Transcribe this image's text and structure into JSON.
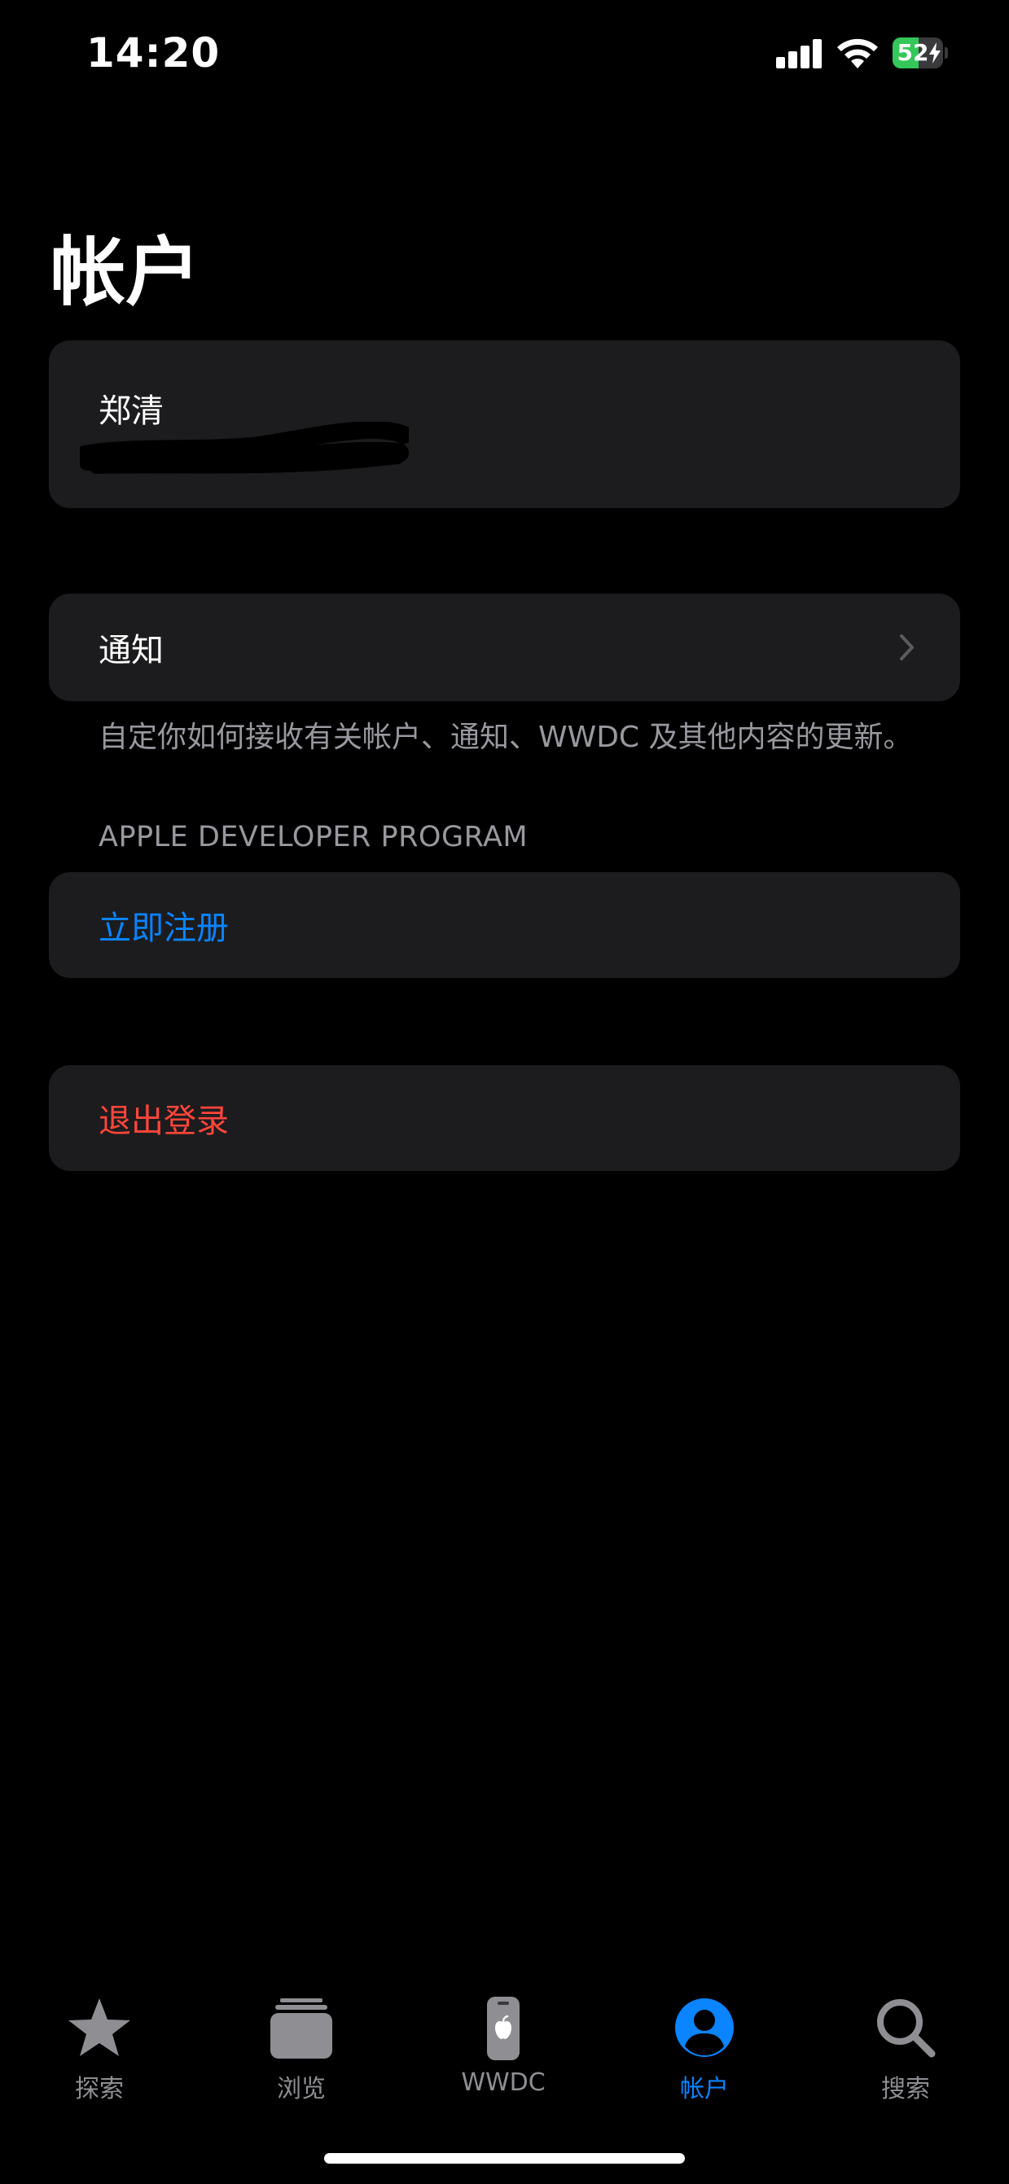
{
  "status_bar": {
    "time": "14:20",
    "battery_level": "52",
    "battery_fraction": 0.52,
    "charging": true,
    "icons": [
      "cellular-signal-icon",
      "wifi-icon",
      "battery-charging-icon"
    ]
  },
  "page": {
    "title": "帐户"
  },
  "profile": {
    "name": "郑清"
  },
  "notifications": {
    "label": "通知",
    "footnote": "自定你如何接收有关帐户、通知、WWDC 及其他内容的更新。"
  },
  "developer_program": {
    "header": "APPLE DEVELOPER PROGRAM",
    "enroll_label": "立即注册"
  },
  "logout": {
    "label": "退出登录"
  },
  "tab_bar": {
    "tabs": [
      {
        "label": "探索",
        "icon": "star-icon",
        "active": false
      },
      {
        "label": "浏览",
        "icon": "stack-icon",
        "active": false
      },
      {
        "label": "WWDC",
        "icon": "wwdc-device-icon",
        "active": false
      },
      {
        "label": "帐户",
        "icon": "person-circle-icon",
        "active": true
      },
      {
        "label": "搜索",
        "icon": "search-icon",
        "active": false
      }
    ]
  },
  "colors": {
    "background": "#000000",
    "card": "#1c1c1e",
    "accent_blue": "#0a84ff",
    "destructive_red": "#ff453a",
    "secondary_text": "#98989f",
    "battery_green": "#34c759"
  }
}
